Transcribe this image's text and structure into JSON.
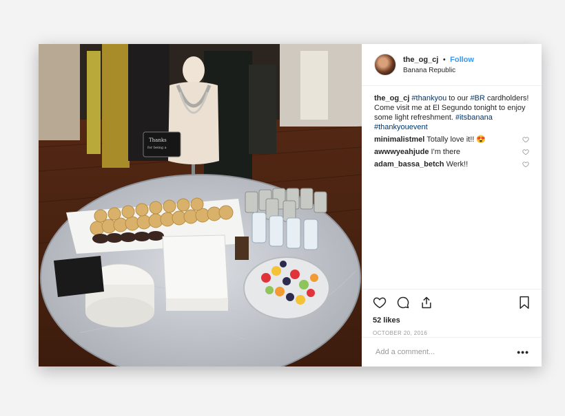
{
  "post": {
    "username": "the_og_cj",
    "follow_label": "Follow",
    "location": "Banana Republic",
    "caption": {
      "username": "the_og_cj",
      "tag_thankyou": "#thankyou",
      "text_1": " to our ",
      "tag_br": "#BR",
      "text_2": " cardholders! Come visit me at El Segundo tonight to enjoy some light refreshment. ",
      "tag_itsbanana": "#itsbanana",
      "tag_thankyouevent": "#thankyouevent"
    },
    "comments": [
      {
        "username": "minimalistmel",
        "text": "Totally love it!! 😍"
      },
      {
        "username": "awwwyeahjude",
        "text": "I'm there"
      },
      {
        "username": "adam_bassa_betch",
        "text": "Werk!!"
      }
    ],
    "likes": "52 likes",
    "date": "OCTOBER 20, 2016",
    "add_comment_placeholder": "Add a comment...",
    "more_label": "•••",
    "sign_text": "Thanks for being a cardmember"
  },
  "icons": {
    "like": "heart-outline",
    "comment": "speech-bubble",
    "share": "share-upload",
    "save": "bookmark",
    "comment_like": "small-heart"
  }
}
